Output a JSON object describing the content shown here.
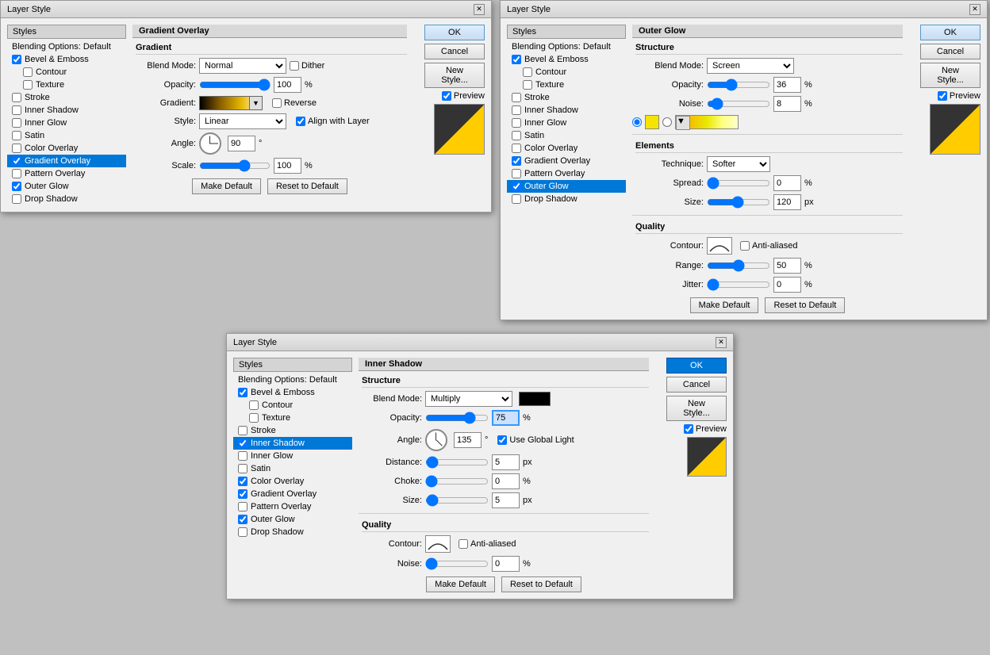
{
  "dialog1": {
    "title": "Layer Style",
    "sidebar": {
      "header": "Styles",
      "items": [
        {
          "label": "Blending Options: Default",
          "checked": false,
          "active": false,
          "sub": false
        },
        {
          "label": "Bevel & Emboss",
          "checked": true,
          "active": false,
          "sub": false
        },
        {
          "label": "Contour",
          "checked": false,
          "active": false,
          "sub": true
        },
        {
          "label": "Texture",
          "checked": false,
          "active": false,
          "sub": true
        },
        {
          "label": "Stroke",
          "checked": false,
          "active": false,
          "sub": false
        },
        {
          "label": "Inner Shadow",
          "checked": false,
          "active": false,
          "sub": false
        },
        {
          "label": "Inner Glow",
          "checked": false,
          "active": false,
          "sub": false
        },
        {
          "label": "Satin",
          "checked": false,
          "active": false,
          "sub": false
        },
        {
          "label": "Color Overlay",
          "checked": false,
          "active": false,
          "sub": false
        },
        {
          "label": "Gradient Overlay",
          "checked": true,
          "active": true,
          "sub": false
        },
        {
          "label": "Pattern Overlay",
          "checked": false,
          "active": false,
          "sub": false
        },
        {
          "label": "Outer Glow",
          "checked": true,
          "active": false,
          "sub": false
        },
        {
          "label": "Drop Shadow",
          "checked": false,
          "active": false,
          "sub": false
        }
      ]
    },
    "panel": {
      "title": "Gradient Overlay",
      "structure_title": "Gradient",
      "blend_mode_label": "Blend Mode:",
      "blend_mode_value": "Normal",
      "dither_label": "Dither",
      "opacity_label": "Opacity:",
      "opacity_value": "100",
      "gradient_label": "Gradient:",
      "reverse_label": "Reverse",
      "style_label": "Style:",
      "style_value": "Linear",
      "align_layer_label": "Align with Layer",
      "angle_label": "Angle:",
      "angle_value": "90",
      "scale_label": "Scale:",
      "scale_value": "100",
      "make_default_label": "Make Default",
      "reset_default_label": "Reset to Default"
    },
    "buttons": {
      "ok": "OK",
      "cancel": "Cancel",
      "new_style": "New Style...",
      "preview": "Preview"
    }
  },
  "dialog2": {
    "title": "Layer Style",
    "sidebar": {
      "header": "Styles",
      "items": [
        {
          "label": "Blending Options: Default",
          "checked": false,
          "active": false,
          "sub": false
        },
        {
          "label": "Bevel & Emboss",
          "checked": true,
          "active": false,
          "sub": false
        },
        {
          "label": "Contour",
          "checked": false,
          "active": false,
          "sub": true
        },
        {
          "label": "Texture",
          "checked": false,
          "active": false,
          "sub": true
        },
        {
          "label": "Stroke",
          "checked": false,
          "active": false,
          "sub": false
        },
        {
          "label": "Inner Shadow",
          "checked": false,
          "active": false,
          "sub": false
        },
        {
          "label": "Inner Glow",
          "checked": false,
          "active": false,
          "sub": false
        },
        {
          "label": "Satin",
          "checked": false,
          "active": false,
          "sub": false
        },
        {
          "label": "Color Overlay",
          "checked": false,
          "active": false,
          "sub": false
        },
        {
          "label": "Gradient Overlay",
          "checked": true,
          "active": false,
          "sub": false
        },
        {
          "label": "Pattern Overlay",
          "checked": false,
          "active": false,
          "sub": false
        },
        {
          "label": "Outer Glow",
          "checked": true,
          "active": true,
          "sub": false
        },
        {
          "label": "Drop Shadow",
          "checked": false,
          "active": false,
          "sub": false
        }
      ]
    },
    "panel": {
      "title": "Outer Glow",
      "structure_title": "Structure",
      "blend_mode_label": "Blend Mode:",
      "blend_mode_value": "Screen",
      "opacity_label": "Opacity:",
      "opacity_value": "36",
      "noise_label": "Noise:",
      "noise_value": "8",
      "elements_title": "Elements",
      "technique_label": "Technique:",
      "technique_value": "Softer",
      "spread_label": "Spread:",
      "spread_value": "0",
      "size_label": "Size:",
      "size_value": "120",
      "size_unit": "px",
      "quality_title": "Quality",
      "contour_label": "Contour:",
      "anti_aliased_label": "Anti-aliased",
      "range_label": "Range:",
      "range_value": "50",
      "jitter_label": "Jitter:",
      "jitter_value": "0",
      "make_default_label": "Make Default",
      "reset_default_label": "Reset to Default"
    },
    "buttons": {
      "ok": "OK",
      "cancel": "Cancel",
      "new_style": "New Style...",
      "preview": "Preview"
    }
  },
  "dialog3": {
    "title": "Layer Style",
    "sidebar": {
      "header": "Styles",
      "items": [
        {
          "label": "Blending Options: Default",
          "checked": false,
          "active": false,
          "sub": false
        },
        {
          "label": "Bevel & Emboss",
          "checked": true,
          "active": false,
          "sub": false
        },
        {
          "label": "Contour",
          "checked": false,
          "active": false,
          "sub": true
        },
        {
          "label": "Texture",
          "checked": false,
          "active": false,
          "sub": true
        },
        {
          "label": "Stroke",
          "checked": false,
          "active": false,
          "sub": false
        },
        {
          "label": "Inner Shadow",
          "checked": true,
          "active": true,
          "sub": false
        },
        {
          "label": "Inner Glow",
          "checked": false,
          "active": false,
          "sub": false
        },
        {
          "label": "Satin",
          "checked": false,
          "active": false,
          "sub": false
        },
        {
          "label": "Color Overlay",
          "checked": true,
          "active": false,
          "sub": false
        },
        {
          "label": "Gradient Overlay",
          "checked": true,
          "active": false,
          "sub": false
        },
        {
          "label": "Pattern Overlay",
          "checked": false,
          "active": false,
          "sub": false
        },
        {
          "label": "Outer Glow",
          "checked": true,
          "active": false,
          "sub": false
        },
        {
          "label": "Drop Shadow",
          "checked": false,
          "active": false,
          "sub": false
        }
      ]
    },
    "panel": {
      "title": "Inner Shadow",
      "structure_title": "Structure",
      "blend_mode_label": "Blend Mode:",
      "blend_mode_value": "Multiply",
      "opacity_label": "Opacity:",
      "opacity_value": "75",
      "angle_label": "Angle:",
      "angle_value": "135",
      "use_global_light_label": "Use Global Light",
      "distance_label": "Distance:",
      "distance_value": "5",
      "distance_unit": "px",
      "choke_label": "Choke:",
      "choke_value": "0",
      "size_label": "Size:",
      "size_value": "5",
      "size_unit": "px",
      "quality_title": "Quality",
      "contour_label": "Contour:",
      "anti_aliased_label": "Anti-aliased",
      "noise_label": "Noise:",
      "noise_value": "0",
      "make_default_label": "Make Default",
      "reset_default_label": "Reset to Default"
    },
    "buttons": {
      "ok": "OK",
      "cancel": "Cancel",
      "new_style": "New Style...",
      "preview": "Preview"
    }
  }
}
